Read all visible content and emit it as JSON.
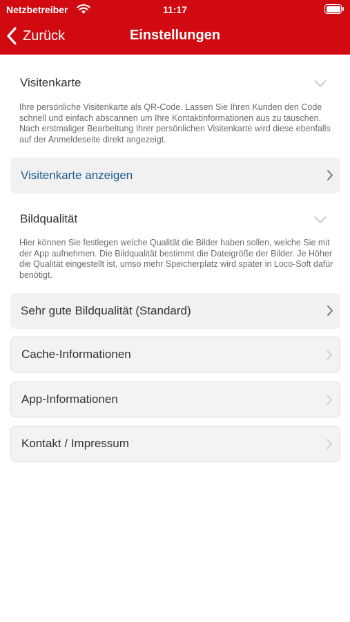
{
  "status_bar": {
    "carrier": "Netzbetreiber",
    "time": "11:17",
    "wifi_icon": "wifi-icon",
    "battery_icon": "battery-icon"
  },
  "nav": {
    "back_label": "Zurück",
    "title": "Einstellungen"
  },
  "sections": {
    "visitenkarte": {
      "heading": "Visitenkarte",
      "description": "Ihre persönliche Visitenkarte als QR-Code. Lassen Sie Ihren Kunden den Code schnell und einfach abscannen um Ihre Kontaktinformationen aus zu tauschen. Nach erstmaliger Bearbeitung Ihrer persönlichen Visitenkarte wird diese ebenfalls auf der Anmeldeseite direkt angezeigt.",
      "action_label": "Visitenkarte anzeigen"
    },
    "bildqualitaet": {
      "heading": "Bildqualität",
      "description": "Hier können Sie festlegen welche Qualität die Bilder haben sollen, welche Sie mit der App aufnehmen. Die Bildqualität bestimmt die Dateigröße der Bilder. Je Höher die Qualität eingestellt ist, umso mehr Speicherplatz wird später in Loco-Soft dafür benötigt.",
      "selected_value": "Sehr gute Bildqualität (Standard)"
    }
  },
  "menu_items": {
    "cache": "Cache-Informationen",
    "app": "App-Informationen",
    "kontakt": "Kontakt / Impressum"
  },
  "colors": {
    "header_red": "#d10a11",
    "link_blue": "#1d5b8f"
  }
}
